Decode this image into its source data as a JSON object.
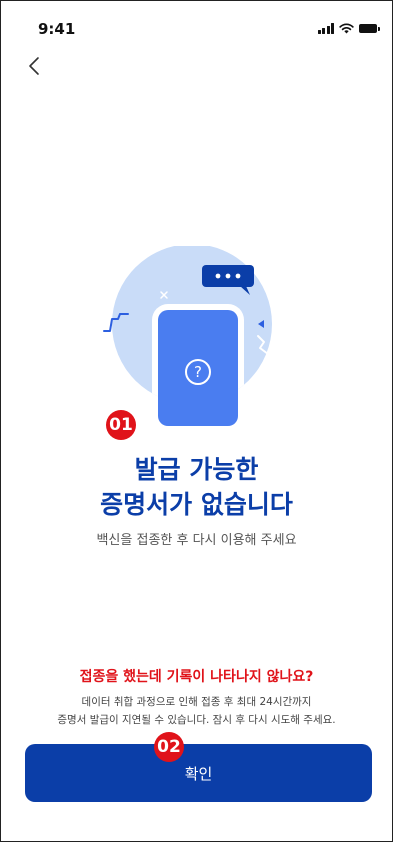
{
  "status_bar": {
    "time": "9:41",
    "icons": [
      "signal-icon",
      "wifi-icon",
      "battery-icon"
    ]
  },
  "nav": {
    "back_icon": "chevron-left-icon"
  },
  "illustration": {
    "icon": "phone-question-icon",
    "question_mark": "?"
  },
  "annotations": {
    "marker_1": "01",
    "marker_2": "02"
  },
  "main": {
    "title_line1": "발급 가능한",
    "title_line2": "증명서가 없습니다",
    "subtitle": "백신을 접종한 후 다시 이용해 주세요"
  },
  "help": {
    "question": "접종을 했는데 기록이 나타나지 않나요?",
    "desc_line1": "데이터 취합 과정으로 인해 접종 후 최대 24시간까지",
    "desc_line2": "증명서 발급이 지연될 수 있습니다. 잠시 후 다시 시도해 주세요."
  },
  "actions": {
    "confirm_label": "확인"
  },
  "colors": {
    "brand_blue": "#0b3ea8",
    "accent_red": "#e0131a",
    "illustration_bg": "#c9dcf8",
    "phone_blue": "#4a7df0"
  }
}
